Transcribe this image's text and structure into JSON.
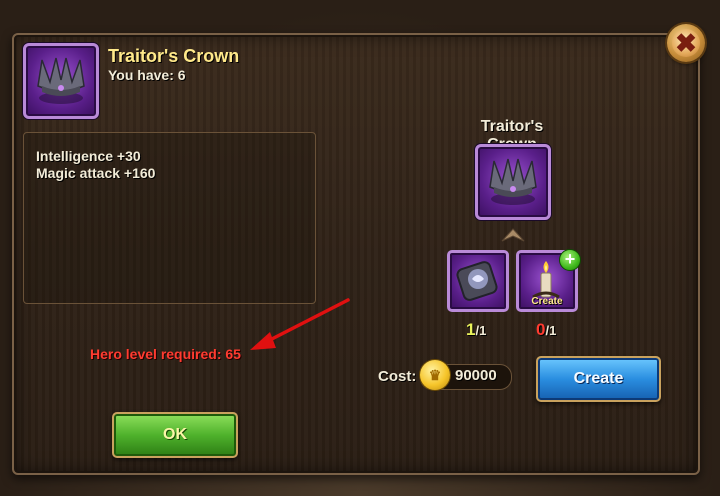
{
  "item": {
    "name": "Traitor's Crown",
    "you_have": "You have: 6",
    "icon": "purple-crown-icon"
  },
  "stats": [
    "Intelligence +30",
    "Magic attack +160"
  ],
  "requirement": "Hero level required: 65",
  "buttons": {
    "ok": "OK",
    "create": "Create",
    "close_icon": "close-x-icon"
  },
  "recipe": {
    "title": "Traitor's Crown",
    "components": [
      {
        "icon": "rune-stone-icon",
        "have": "1",
        "need": "/1",
        "have_color": "#e9f25a"
      },
      {
        "icon": "candle-icon",
        "have": "0",
        "need": "/1",
        "have_color": "#ff3b30",
        "action_label": "Create"
      }
    ],
    "cost_label": "Cost:",
    "cost_value": "90000",
    "cost_icon": "gold-coin-icon"
  },
  "colors": {
    "title": "#ffe98a",
    "requirement": "#ff3b30",
    "ok_button": "#4fb22c",
    "create_button": "#2a8ee0",
    "item_frame": "#b98ad8"
  }
}
